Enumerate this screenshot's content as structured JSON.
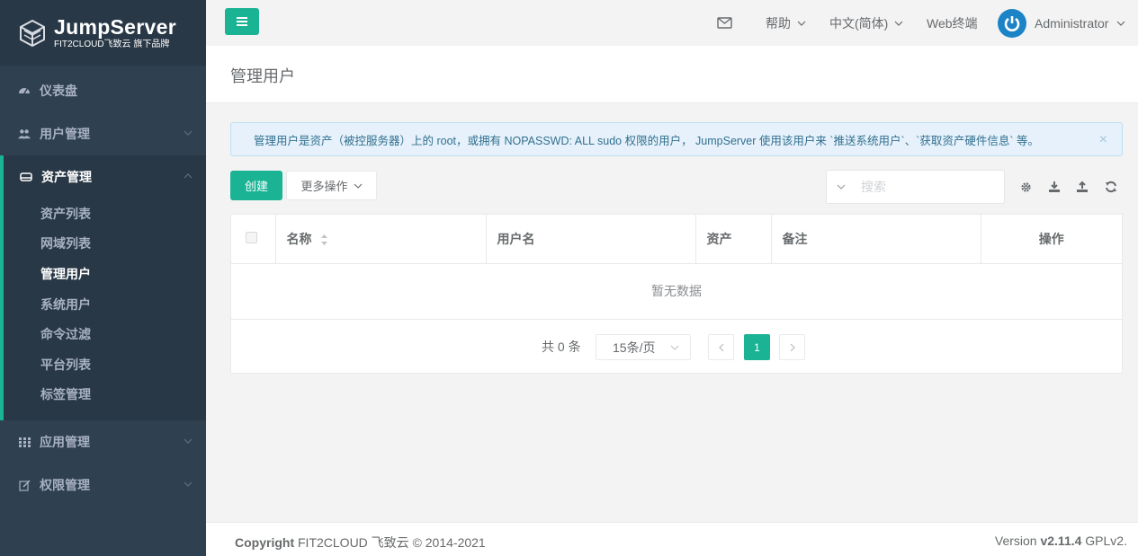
{
  "logo": {
    "brand": "JumpServer",
    "tagline": "FIT2CLOUD飞致云 旗下品牌"
  },
  "sidebar": {
    "items": [
      {
        "label": "仪表盘",
        "icon": "dashboard-icon"
      },
      {
        "label": "用户管理",
        "icon": "users-icon"
      },
      {
        "label": "资产管理",
        "icon": "hdd-icon"
      },
      {
        "label": "应用管理",
        "icon": "grid-icon"
      },
      {
        "label": "权限管理",
        "icon": "edit-icon"
      }
    ],
    "asset_sub": [
      {
        "label": "资产列表"
      },
      {
        "label": "网域列表"
      },
      {
        "label": "管理用户"
      },
      {
        "label": "系统用户"
      },
      {
        "label": "命令过滤"
      },
      {
        "label": "平台列表"
      },
      {
        "label": "标签管理"
      }
    ]
  },
  "topbar": {
    "help": "帮助",
    "language": "中文(简体)",
    "web_terminal": "Web终端",
    "user": "Administrator"
  },
  "page": {
    "title": "管理用户"
  },
  "alert": {
    "text": "管理用户是资产（被控服务器）上的 root，或拥有 NOPASSWD: ALL sudo 权限的用户， JumpServer 使用该用户来 `推送系统用户`、`获取资产硬件信息` 等。",
    "close": "×"
  },
  "toolbar": {
    "create": "创建",
    "more": "更多操作",
    "search_placeholder": "搜索"
  },
  "table": {
    "columns": [
      "名称",
      "用户名",
      "资产",
      "备注",
      "操作"
    ],
    "empty": "暂无数据"
  },
  "pagination": {
    "total": "共 0 条",
    "page_size": "15条/页",
    "current_page": "1"
  },
  "footer": {
    "copyright_bold": "Copyright",
    "copyright_rest": " FIT2CLOUD 飞致云 © 2014-2021",
    "version_prefix": "Version ",
    "version": "v2.11.4",
    "license": " GPLv2."
  },
  "colors": {
    "primary": "#1ab394",
    "sidebar": "#2f4050",
    "sidebar_dark": "#293846",
    "info_text": "#31708f",
    "avatar": "#1c84c6"
  }
}
